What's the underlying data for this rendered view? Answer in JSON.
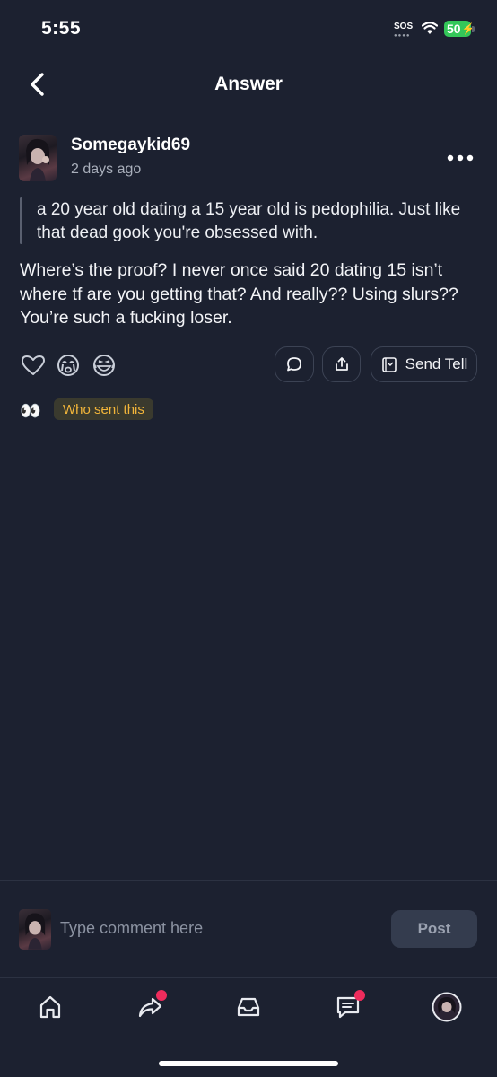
{
  "status_bar": {
    "time": "5:55",
    "sos": "SOS",
    "battery": "50"
  },
  "header": {
    "title": "Answer"
  },
  "post": {
    "username": "Somegaykid69",
    "time_ago": "2 days ago",
    "question": "a 20 year old dating a 15 year old is pedophilia. Just like that dead gook you're obsessed with.",
    "answer": "Where’s the proof? I never once said 20 dating 15 isn’t where tf are you getting that? And really?? Using slurs?? You’re such a fucking loser."
  },
  "actions": {
    "send_tell_label": "Send Tell"
  },
  "who_sent": {
    "emoji": "👀",
    "label": "Who sent this"
  },
  "comment": {
    "placeholder": "Type comment here",
    "post_label": "Post"
  },
  "tab_bar": {
    "items": [
      {
        "name": "home",
        "icon": "home-icon",
        "badge": false
      },
      {
        "name": "share",
        "icon": "share-icon",
        "badge": true
      },
      {
        "name": "inbox",
        "icon": "inbox-icon",
        "badge": false
      },
      {
        "name": "messages",
        "icon": "chat-icon",
        "badge": true
      },
      {
        "name": "profile",
        "icon": "avatar",
        "badge": false
      }
    ]
  },
  "colors": {
    "background": "#1c2130",
    "accent_badge": "#ee2c5c",
    "who_sent_text": "#f2b53a",
    "battery": "#34c759"
  }
}
